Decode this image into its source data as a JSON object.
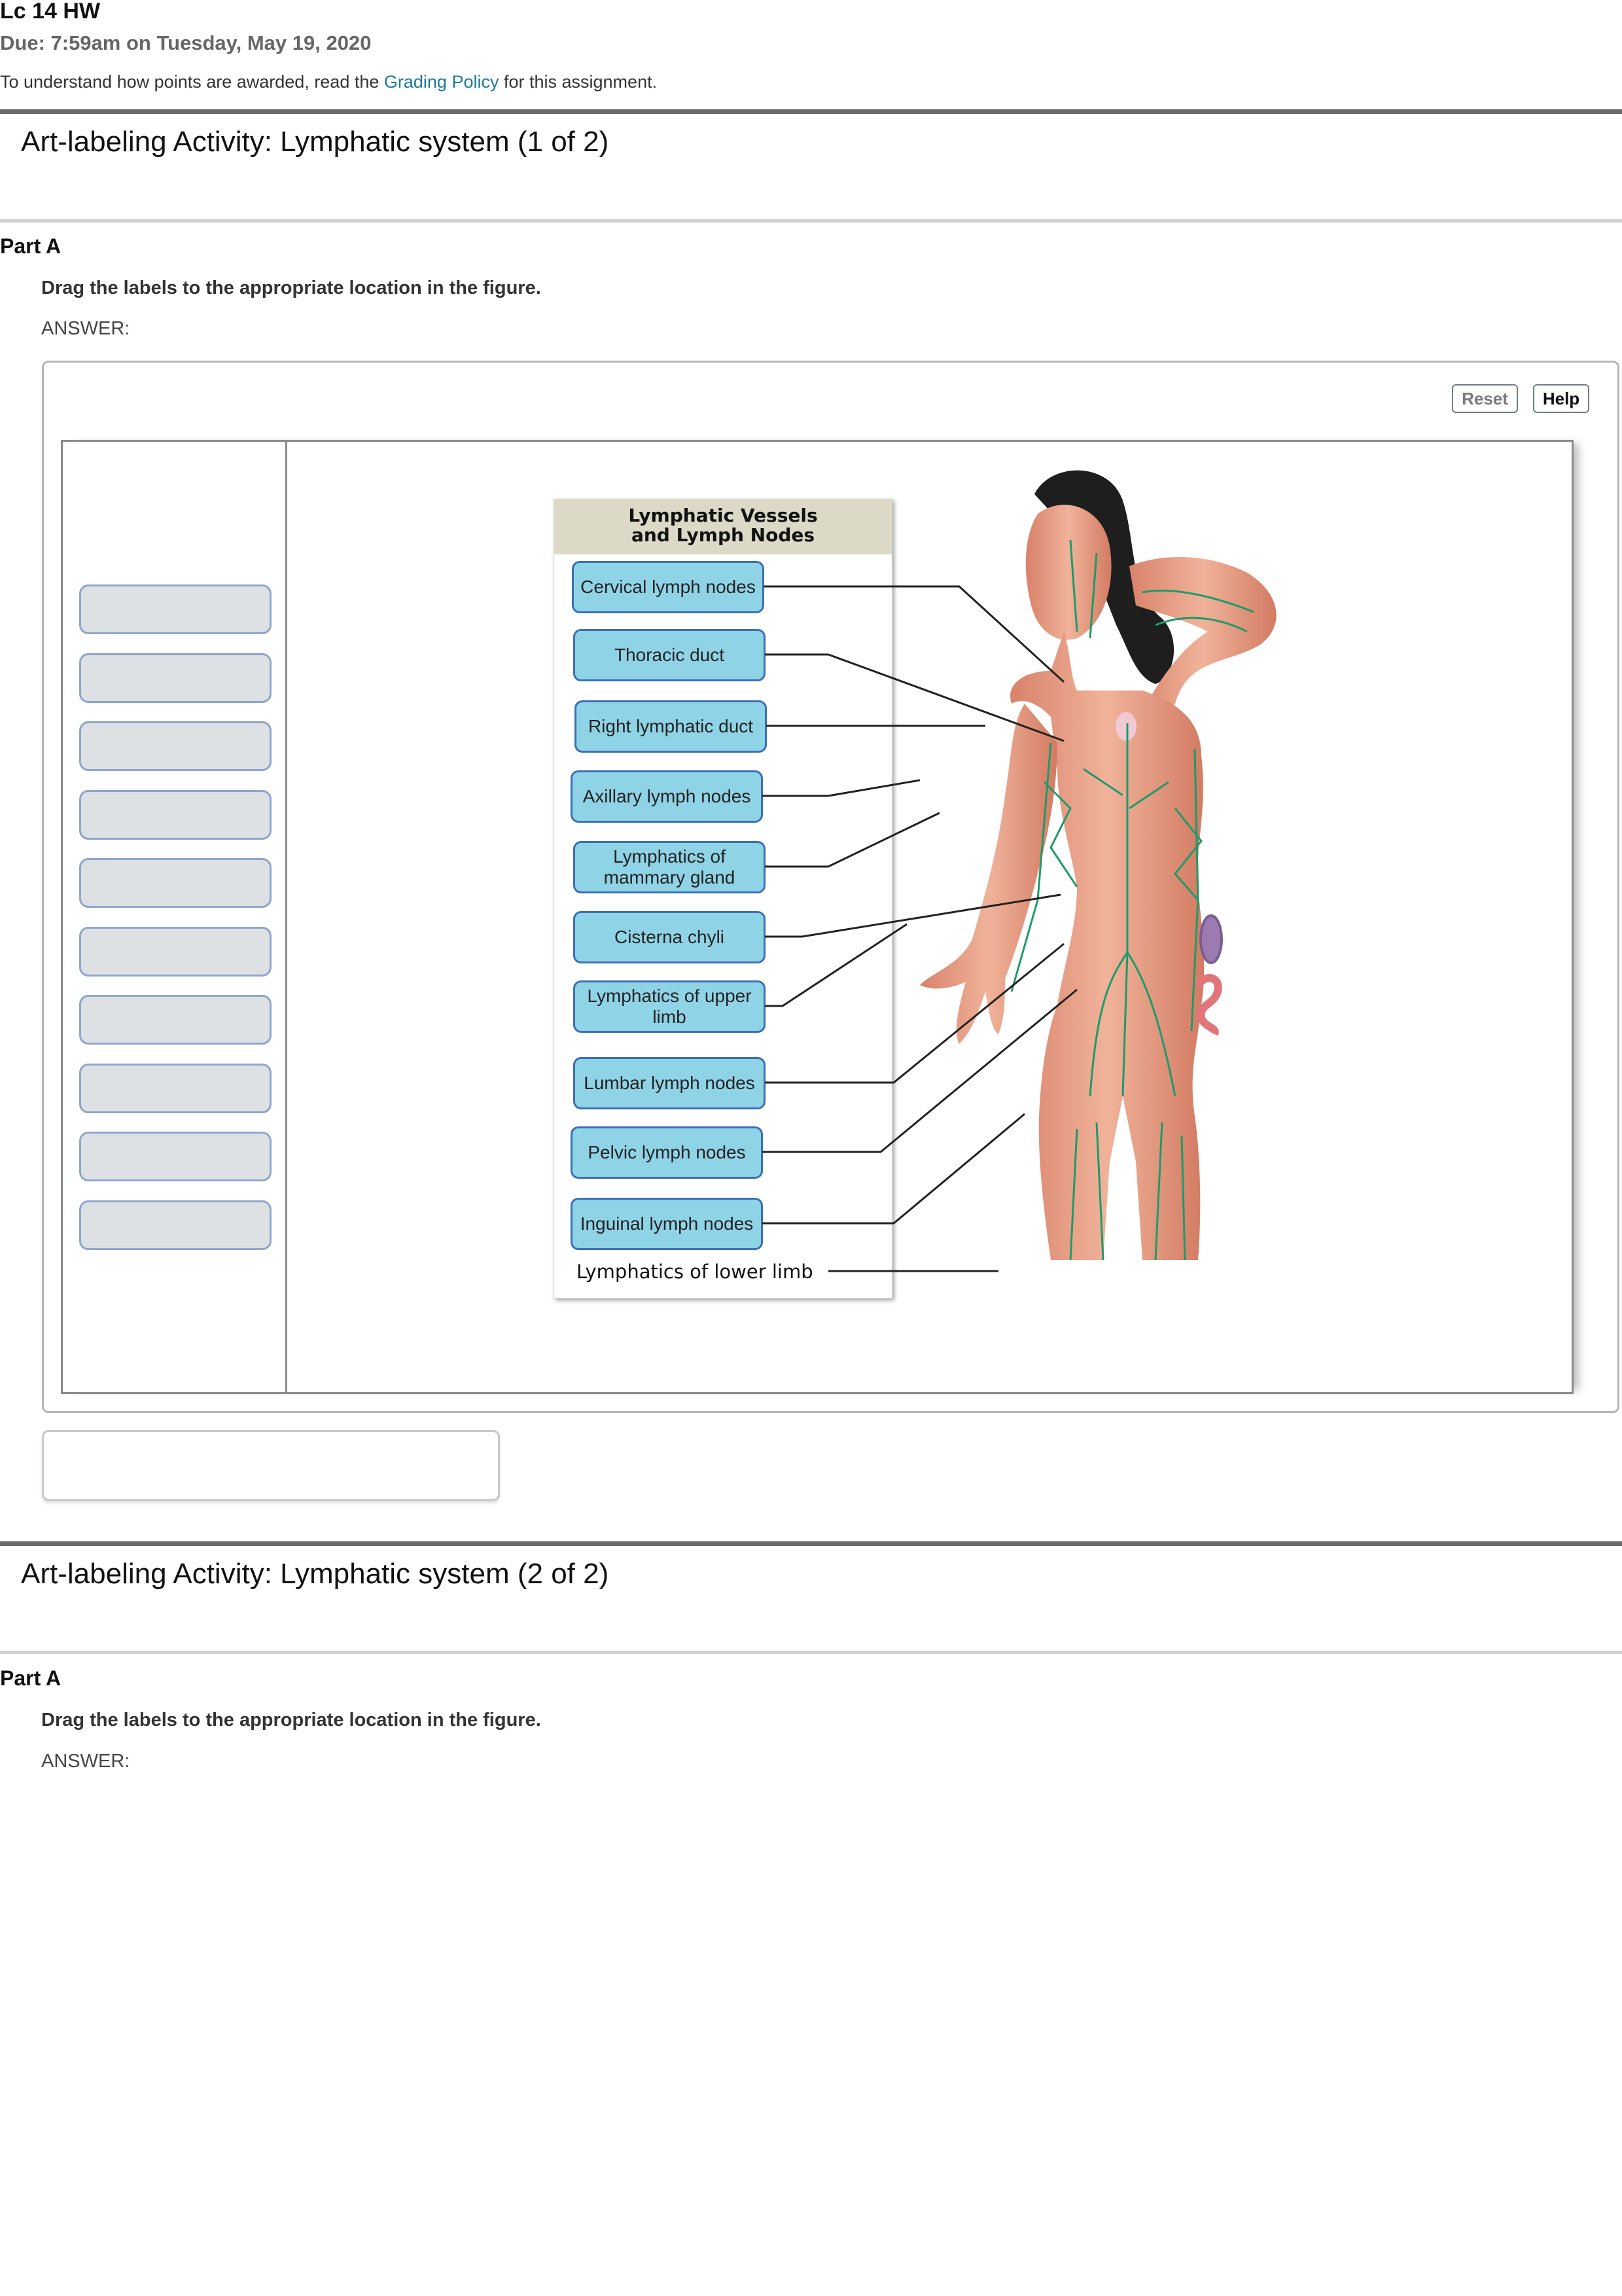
{
  "header": {
    "title": "Lc 14 HW",
    "due": "Due: 7:59am on Tuesday, May 19, 2020",
    "policy_prefix": "To understand how points are awarded, read the ",
    "policy_link": "Grading Policy",
    "policy_suffix": " for this assignment."
  },
  "sections": [
    {
      "title": "Art-labeling Activity: Lymphatic system (1 of 2)",
      "part": "Part A",
      "prompt": "Drag the labels to the appropriate location in the figure.",
      "answer_label": "ANSWER:",
      "toolbar": {
        "reset_label": "Reset",
        "help_label": "Help"
      },
      "label_bank_slots": 10,
      "figure": {
        "header_line1": "Lymphatic Vessels",
        "header_line2": "and Lymph Nodes",
        "drop_labels": [
          "Cervical lymph nodes",
          "Thoracic duct",
          "Right lymphatic duct",
          "Axillary lymph nodes",
          "Lymphatics of mammary gland",
          "Cisterna chyli",
          "Lymphatics of upper limb",
          "Lumbar lymph nodes",
          "Pelvic lymph nodes",
          "Inguinal lymph nodes"
        ],
        "static_label": "Lymphatics of lower limb",
        "colors": {
          "label_fill": "#8fd3e6",
          "label_border": "#3c6fb5",
          "slot_fill": "#dde1e3",
          "slot_border": "#8fa5cc",
          "vessel": "#1f9a6a",
          "skin": "#e9a184"
        }
      }
    },
    {
      "title": "Art-labeling Activity: Lymphatic system (2 of 2)",
      "part": "Part A",
      "prompt": "Drag the labels to the appropriate location in the figure.",
      "answer_label": "ANSWER:"
    }
  ],
  "colors": {
    "link": "#1a7a9a",
    "rule_dark": "#6b6b6b",
    "rule_light": "#cfcfcf"
  }
}
